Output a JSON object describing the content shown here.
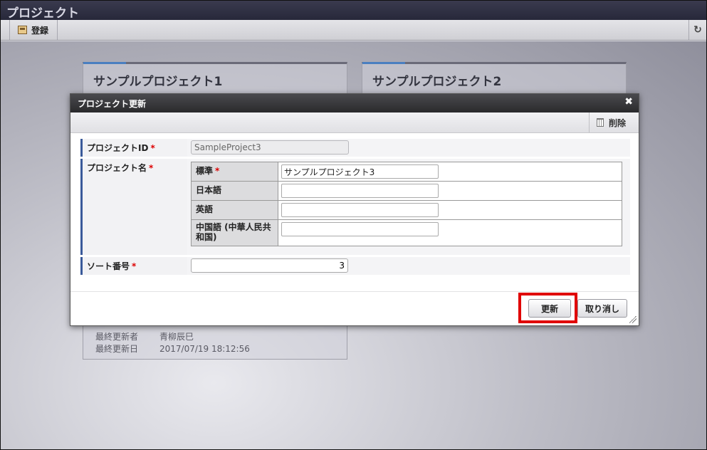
{
  "app": {
    "title": "プロジェクト"
  },
  "toolbar": {
    "register_label": "登録",
    "refresh_icon": "refresh-icon"
  },
  "cards": [
    {
      "title": "サンプルプロジェクト1"
    },
    {
      "title": "サンプルプロジェクト2"
    }
  ],
  "meta": {
    "updated_by_label": "最終更新者",
    "updated_by": "青柳辰巳",
    "updated_at_label": "最終更新日",
    "updated_at": "2017/07/19 18:12:56"
  },
  "modal": {
    "title": "プロジェクト更新",
    "delete_label": "削除",
    "fields": {
      "project_id": {
        "label": "プロジェクトID",
        "value": "SampleProject3"
      },
      "project_name": {
        "label": "プロジェクト名",
        "locales": [
          {
            "label": "標準",
            "required": true,
            "value": "サンプルプロジェクト3"
          },
          {
            "label": "日本語",
            "required": false,
            "value": ""
          },
          {
            "label": "英語",
            "required": false,
            "value": ""
          },
          {
            "label": "中国語 (中華人民共和国)",
            "required": false,
            "value": ""
          }
        ]
      },
      "sort_no": {
        "label": "ソート番号",
        "value": "3"
      }
    },
    "required_mark": "*",
    "update_label": "更新",
    "cancel_label": "取り消し"
  }
}
